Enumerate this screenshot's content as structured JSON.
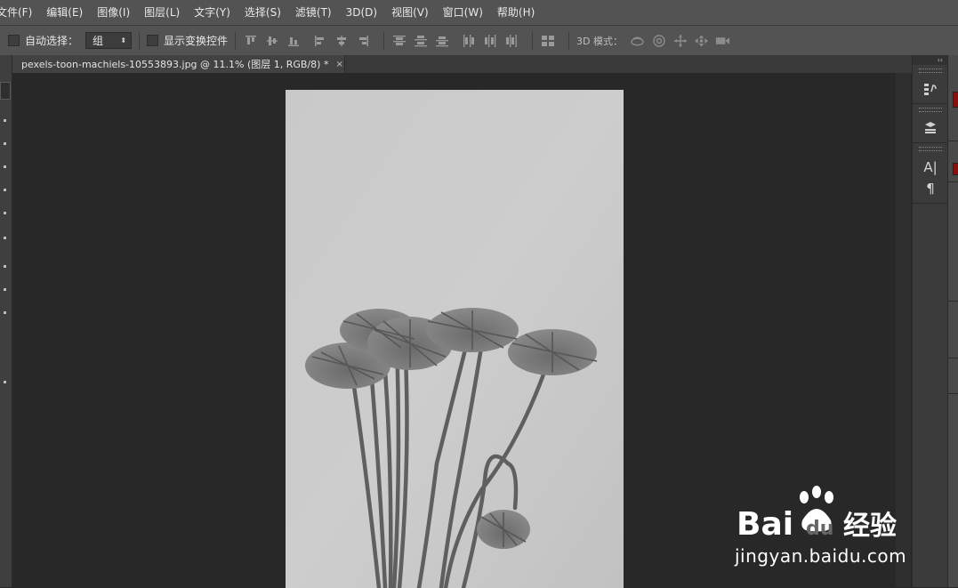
{
  "menu": [
    {
      "label": "文件(F)"
    },
    {
      "label": "编辑(E)"
    },
    {
      "label": "图像(I)"
    },
    {
      "label": "图层(L)"
    },
    {
      "label": "文字(Y)"
    },
    {
      "label": "选择(S)"
    },
    {
      "label": "滤镜(T)"
    },
    {
      "label": "3D(D)"
    },
    {
      "label": "视图(V)"
    },
    {
      "label": "窗口(W)"
    },
    {
      "label": "帮助(H)"
    }
  ],
  "options": {
    "auto_select_label": "自动选择：",
    "auto_select_value": "组",
    "show_transform_label": "显示变换控件",
    "mode_3d_label": "3D 模式："
  },
  "document": {
    "tab_title": "pexels-toon-machiels-10553893.jpg @ 11.1% (图层 1, RGB/8) *",
    "close_glyph": "×"
  },
  "dock": {
    "collapse_glyph": "‹‹",
    "char_label": "A|",
    "para_label": "¶"
  },
  "watermark": {
    "brand": "Bai",
    "brand2": "du",
    "product": "经验",
    "url": "jingyan.baidu.com"
  },
  "colors": {
    "menubar": "#535353",
    "workspace": "#282828",
    "accent_red": "#8b1010"
  }
}
